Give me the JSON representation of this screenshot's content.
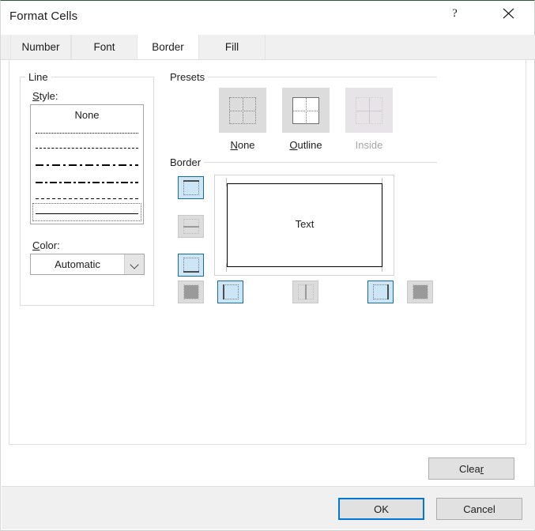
{
  "window": {
    "title": "Format Cells",
    "help_icon": "question-mark-icon",
    "help_glyph": "?",
    "close_icon": "close-icon"
  },
  "tabs": [
    {
      "label": "Number",
      "active": false
    },
    {
      "label": "Font",
      "active": false
    },
    {
      "label": "Border",
      "active": true
    },
    {
      "label": "Fill",
      "active": false
    }
  ],
  "line_group": {
    "title": "Line",
    "style_label": "Style:",
    "style_accel": "S",
    "none_option": "None",
    "style_options": [
      "None",
      "Dotted",
      "Fine dashed",
      "Dash dot long",
      "Dash dot",
      "Medium dashed",
      "Solid thin"
    ],
    "selected_style": "Solid thin",
    "color_label": "Color:",
    "color_accel": "C",
    "color_value": "Automatic",
    "color_dropdown_icon": "chevron-down-icon"
  },
  "presets": {
    "title": "Presets",
    "items": [
      {
        "label": "None",
        "accel": "N",
        "state": "enabled",
        "glyph": "preset-none-icon"
      },
      {
        "label": "Outline",
        "accel": "O",
        "state": "enabled",
        "glyph": "preset-outline-icon"
      },
      {
        "label": "Inside",
        "accel": "I",
        "state": "disabled",
        "glyph": "preset-inside-icon"
      }
    ]
  },
  "border": {
    "title": "Border",
    "preview_text": "Text",
    "preview_edges": {
      "top": true,
      "bottom": true,
      "left": true,
      "right": true
    },
    "buttons": [
      {
        "name": "top-border",
        "state": "selected",
        "icon": "border-top-icon"
      },
      {
        "name": "horizontal-border",
        "state": "disabled",
        "icon": "border-horizontal-icon"
      },
      {
        "name": "bottom-border",
        "state": "selected",
        "icon": "border-bottom-icon"
      },
      {
        "name": "diagonal-up-border",
        "state": "disabled",
        "icon": "border-diagonal-up-icon"
      },
      {
        "name": "left-border",
        "state": "selected",
        "icon": "border-left-icon"
      },
      {
        "name": "vertical-border",
        "state": "disabled",
        "icon": "border-vertical-icon"
      },
      {
        "name": "right-border",
        "state": "selected",
        "icon": "border-right-icon"
      },
      {
        "name": "diagonal-down-border",
        "state": "disabled",
        "icon": "border-diagonal-down-icon"
      }
    ]
  },
  "actions": {
    "clear": "Clear",
    "clear_accel": "r",
    "ok": "OK",
    "cancel": "Cancel",
    "default_button": "OK"
  },
  "colors": {
    "accent": "#0078d7",
    "selected_button_fill": "#cce6f7",
    "selected_button_border": "#136ca4",
    "button_face": "#e1e1e1",
    "panel": "#ffffff",
    "tabstrip": "#f0f0f0"
  }
}
